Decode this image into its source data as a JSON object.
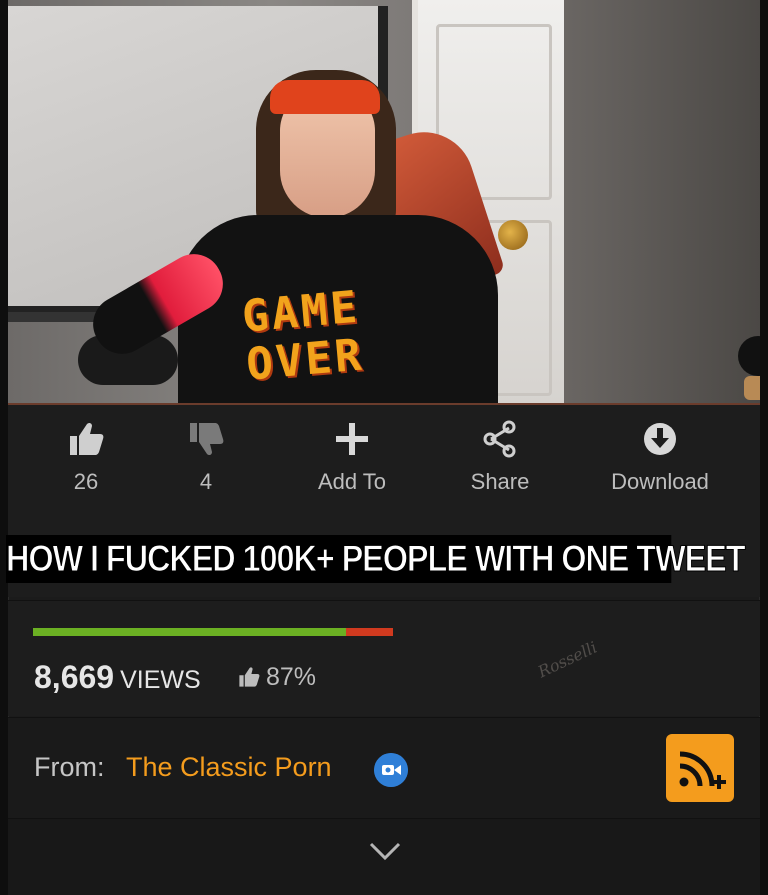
{
  "actions": {
    "like_count": "26",
    "dislike_count": "4",
    "add_label": "Add To",
    "share_label": "Share",
    "download_label": "Download"
  },
  "title": "HOW I FUCKED 100K+ PEOPLE WITH ONE TWEET",
  "video": {
    "shirt_text": "GAME OVER"
  },
  "stats": {
    "views_number": "8,669",
    "views_word": "VIEWS",
    "rating": "87%",
    "rating_fraction": 0.87,
    "watermark": "Rosselli"
  },
  "from": {
    "label": "From:",
    "channel": "The Classic Porn"
  },
  "colors": {
    "accent": "#f49c1d",
    "rating_good": "#6bb023",
    "rating_bad": "#d13a1f",
    "verified": "#2f7fd7"
  }
}
